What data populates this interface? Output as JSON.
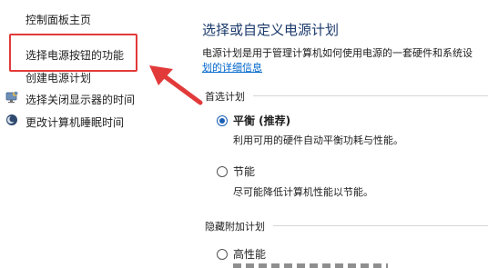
{
  "sidebar": {
    "items": [
      {
        "label": "控制面板主页"
      },
      {
        "label": "选择电源按钮的功能"
      },
      {
        "label": "创建电源计划"
      },
      {
        "label": "选择关闭显示器的时间"
      },
      {
        "label": "更改计算机睡眠时间"
      }
    ]
  },
  "main": {
    "title": "选择或自定义电源计划",
    "description_line1": "电源计划是用于管理计算机如何使用电源的一套硬件和系统设",
    "description_link": "划的详细信息",
    "preferred_section": "首选计划",
    "hidden_section": "隐藏附加计划",
    "plans": [
      {
        "name": "平衡 (推荐)",
        "desc": "利用可用的硬件自动平衡功耗与性能。",
        "selected": true
      },
      {
        "name": "节能",
        "desc": "尽可能降低计算机性能以节能。",
        "selected": false
      },
      {
        "name": "高性能",
        "desc": "",
        "selected": false
      }
    ]
  },
  "annotation": {
    "highlight_color": "#e23a3a",
    "arrow_color": "#e23a3a"
  },
  "colors": {
    "title": "#1b3a6b",
    "link": "#0066cc",
    "radio_selected": "#1a5fb4"
  }
}
